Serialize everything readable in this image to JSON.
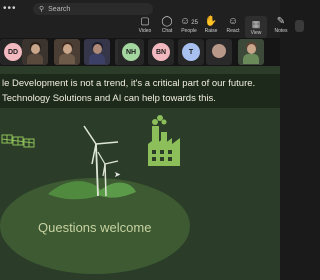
{
  "topbar": {
    "menu_icon": "more-dots-icon",
    "menu_glyph": "•••",
    "search_icon": "search-icon",
    "search_placeholder": "Search"
  },
  "meeting_controls": [
    {
      "name": "new-video",
      "label": "Video",
      "icon": "video-icon"
    },
    {
      "name": "chat",
      "label": "Chat",
      "icon": "chat-icon"
    },
    {
      "name": "people",
      "label": "People",
      "icon": "people-icon",
      "count": "25"
    },
    {
      "name": "raise",
      "label": "Raise",
      "icon": "raise-hand-icon"
    },
    {
      "name": "react",
      "label": "React",
      "icon": "react-icon"
    },
    {
      "name": "view",
      "label": "View",
      "icon": "view-icon"
    },
    {
      "name": "notes",
      "label": "Notes",
      "icon": "notes-icon"
    }
  ],
  "participants": [
    {
      "initials": "DD",
      "color": "#f2b8c0"
    },
    {
      "initials": "",
      "photo": true
    },
    {
      "initials": "",
      "photo": true
    },
    {
      "initials": "",
      "photo": true,
      "muted": true
    },
    {
      "initials": "NH",
      "color": "#a4d6a0"
    },
    {
      "initials": "BN",
      "color": "#f2b8c0"
    },
    {
      "initials": "T",
      "color": "#a8c0f0"
    },
    {
      "initials": "",
      "photo": true
    }
  ],
  "slide": {
    "line1": "le Development is not a trend, it's a critical part of our future.",
    "line2": "Technology Solutions and AI can help towards this.",
    "questions": "Questions welcome",
    "colors": {
      "background": "#2b3d28",
      "banner": "#1d2a1b",
      "oval": "#3d5a33",
      "leaf": "#4f8a3f",
      "icon_green": "#8cbf5a"
    }
  }
}
